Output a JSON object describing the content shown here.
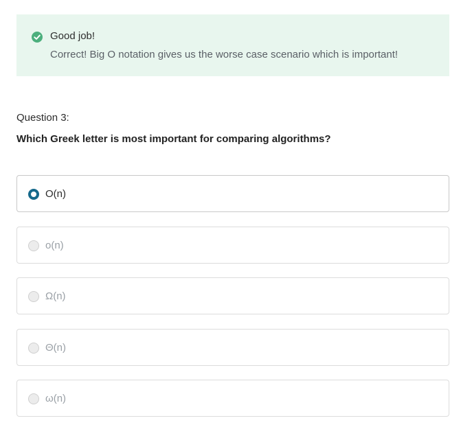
{
  "feedback": {
    "title": "Good job!",
    "message": "Correct! Big O notation gives us the worse case scenario which is important!",
    "icon": "check-circle-icon",
    "color": "#4caf7d",
    "background": "#e8f6ee"
  },
  "question": {
    "number_label": "Question 3:",
    "text": "Which Greek letter is most important for comparing algorithms?"
  },
  "options": [
    {
      "label": "O(n)",
      "selected": true
    },
    {
      "label": "o(n)",
      "selected": false
    },
    {
      "label": "Ω(n)",
      "selected": false
    },
    {
      "label": "Θ(n)",
      "selected": false
    },
    {
      "label": "ω(n)",
      "selected": false
    }
  ],
  "colors": {
    "selected_radio": "#15698b"
  }
}
